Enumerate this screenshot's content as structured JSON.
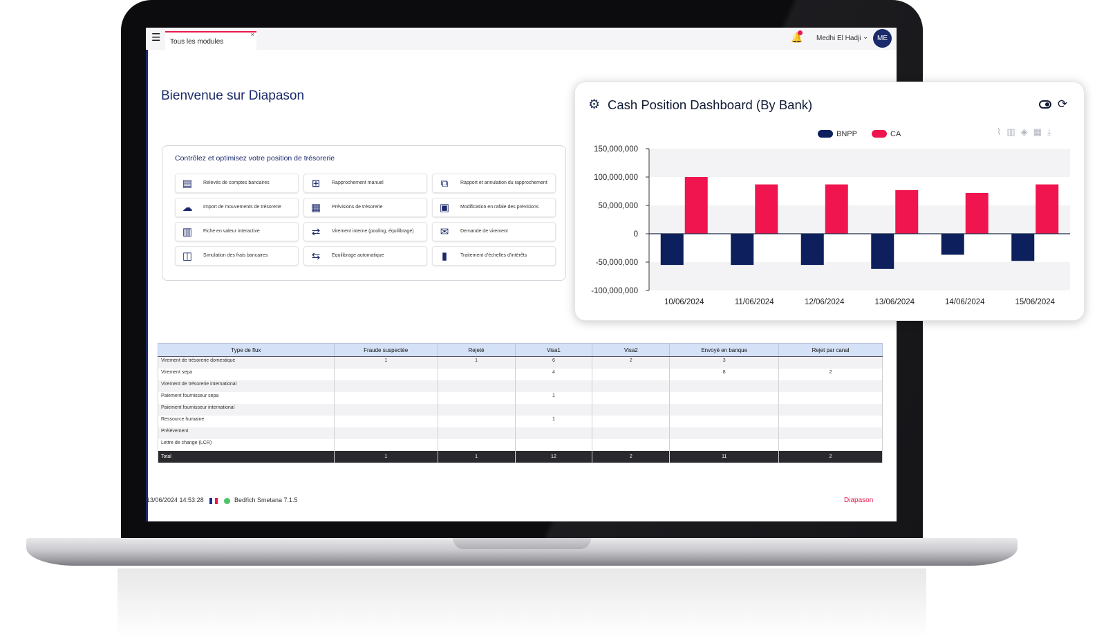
{
  "topbar": {
    "tab_label": "Tous les modules",
    "tab_close": "×",
    "notification_count": "1",
    "user_name": "Medhi El Hadji",
    "avatar_initials": "ME"
  },
  "welcome_title": "Bienvenue sur Diapason",
  "modules_card": {
    "title": "Contrôlez et optimisez votre position de trésorerie",
    "items": [
      {
        "label": "Relevés de comptes bancaires",
        "icon": "bank-statement-icon"
      },
      {
        "label": "Rapprochement manuel",
        "icon": "manual-matching-icon"
      },
      {
        "label": "Rapport et annulation du rapprochement",
        "icon": "matching-report-icon"
      },
      {
        "label": "Import de mouvements de trésorerie",
        "icon": "cloud-import-icon"
      },
      {
        "label": "Prévisions de trésorerie",
        "icon": "forecast-icon"
      },
      {
        "label": "Modification en rafale des prévisions",
        "icon": "grid-edit-icon"
      },
      {
        "label": "Fiche en valeur interactive",
        "icon": "value-sheet-icon"
      },
      {
        "label": "Virement interne (pooling, équilibrage)",
        "icon": "internal-transfer-icon"
      },
      {
        "label": "Demande de virement",
        "icon": "transfer-request-icon"
      },
      {
        "label": "Simulation des frais bancaires",
        "icon": "fee-simulation-icon"
      },
      {
        "label": "Equilibrage automatique",
        "icon": "auto-balance-icon"
      },
      {
        "label": "Traitement d'échelles d'intérêts",
        "icon": "interest-chart-icon"
      }
    ]
  },
  "flow_table": {
    "headers": [
      "Type de flux",
      "Fraude suspectée",
      "Rejeté",
      "Visa1",
      "Visa2",
      "Envoyé en banque",
      "Rejet par canal"
    ],
    "rows": [
      [
        "Virement de trésorerie domestique",
        "1",
        "1",
        "6",
        "2",
        "3",
        ""
      ],
      [
        "Virement sepa",
        "",
        "",
        "4",
        "",
        "8",
        "2"
      ],
      [
        "Virement de trésorerie international",
        "",
        "",
        "",
        "",
        "",
        ""
      ],
      [
        "Paiement fournisseur sepa",
        "",
        "",
        "1",
        "",
        "",
        ""
      ],
      [
        "Paiement fournisseur international",
        "",
        "",
        "",
        "",
        "",
        ""
      ],
      [
        "Ressource humaine",
        "",
        "",
        "1",
        "",
        "",
        ""
      ],
      [
        "Prélèvement",
        "",
        "",
        "",
        "",
        "",
        ""
      ],
      [
        "Lettre de change (LCR)",
        "",
        "",
        "",
        "",
        "",
        ""
      ]
    ],
    "total": [
      "Total",
      "1",
      "1",
      "12",
      "2",
      "11",
      "2"
    ]
  },
  "status_bar": {
    "timestamp": "13/06/2024 14:53:28",
    "version": "Bedřich Smetana 7.1.5",
    "brand": "Diapason"
  },
  "chart_card": {
    "title": "Cash Position Dashboard (By Bank)",
    "toolbar_icons": [
      "line-chart-icon",
      "bar-chart-icon",
      "stack-icon",
      "grid-icon",
      "download-icon"
    ]
  },
  "chart_data": {
    "type": "bar",
    "categories": [
      "10/06/2024",
      "11/06/2024",
      "12/06/2024",
      "13/06/2024",
      "14/06/2024",
      "15/06/2024"
    ],
    "series": [
      {
        "name": "BNPP",
        "color": "#0d1f5c",
        "values": [
          -55000000,
          -55000000,
          -55000000,
          -62000000,
          -37000000,
          -48000000
        ]
      },
      {
        "name": "CA",
        "color": "#f0154f",
        "values": [
          100000000,
          87000000,
          87000000,
          77000000,
          72000000,
          87000000
        ]
      }
    ],
    "ylim": [
      -100000000,
      150000000
    ],
    "yticks": [
      150000000,
      100000000,
      50000000,
      0,
      -50000000,
      -100000000
    ],
    "ytick_labels": [
      "150,000,000",
      "100,000,000",
      "50,000,000",
      "0",
      "-50,000,000",
      "-100,000,000"
    ],
    "legend_position": "top-center",
    "grid": "alternating bands"
  }
}
